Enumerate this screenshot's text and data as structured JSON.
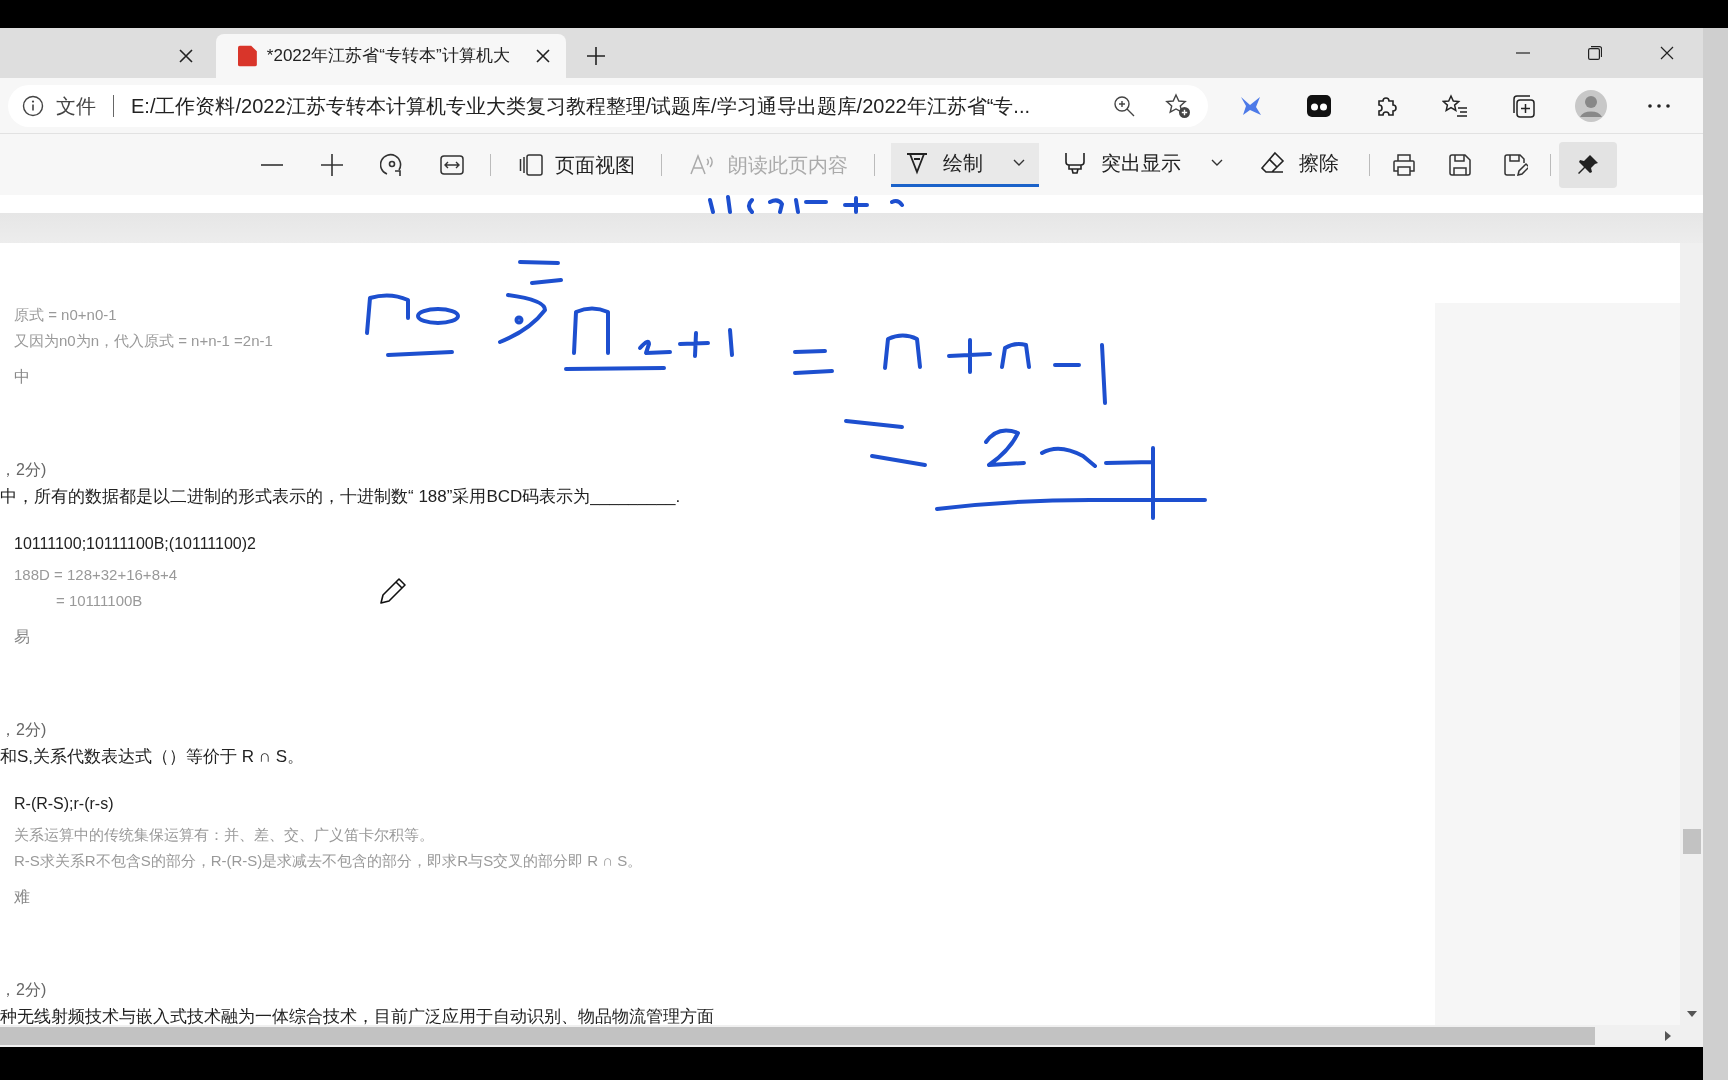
{
  "tabs": [
    {
      "selected": false
    },
    {
      "title": "*2022年江苏省“专转本”计算机大",
      "selected": true
    }
  ],
  "address_bar": {
    "label": "文件",
    "url": "E:/工作资料/2022江苏专转本计算机专业大类复习教程整理/试题库/学习通导出题库/2022年江苏省“专..."
  },
  "toolbar": {
    "view_button": {
      "label": "页面视图"
    },
    "read_aloud": {
      "label": "朗读此页内容",
      "disabled": true
    },
    "tools": [
      {
        "label": "绘制",
        "selected": true,
        "dropdown": true
      },
      {
        "label": "突出显示",
        "selected": false,
        "dropdown": true
      },
      {
        "label": "擦除",
        "selected": false,
        "dropdown": false
      }
    ]
  },
  "questions": [
    {
      "explanation": [
        {
          "text": "原式 = n0+n0-1",
          "kind": "line"
        },
        {
          "text": "又因为n0为n，代入原式 = n+n-1 =2n-1",
          "kind": "line"
        }
      ],
      "difficulty": "中"
    },
    {
      "score": "，2分)",
      "question": "中，所有的数据都是以二进制的形式表示的，十进制数“ 188”采用BCD码表示为_________.",
      "answer": "10111100;10111100B;(10111100)2",
      "explanation": [
        {
          "text": "188D = 128+32+16+8+4",
          "kind": "line"
        },
        {
          "text": "= 10111100B",
          "kind": "continuation"
        }
      ],
      "difficulty": "易"
    },
    {
      "score": "，2分)",
      "question": "和S,关系代数表达式（）等价于 R ∩ S。",
      "answer": "R-(R-S);r-(r-s)",
      "explanation": [
        {
          "text": "关系运算中的传统集保运算有：并、差、交、广义笛卡尔积等。",
          "kind": "line"
        },
        {
          "text": "R-S求关系R不包含S的部分，R-(R-S)是求减去不包含的部分，即求R与S交叉的部分即 R ∩ S。",
          "kind": "line"
        }
      ],
      "difficulty": "难"
    },
    {
      "score": "，2分)",
      "question": "种无线射频技术与嵌入式技术融为一体综合技术，目前广泛应用于自动识别、物品物流管理方面"
    }
  ]
}
